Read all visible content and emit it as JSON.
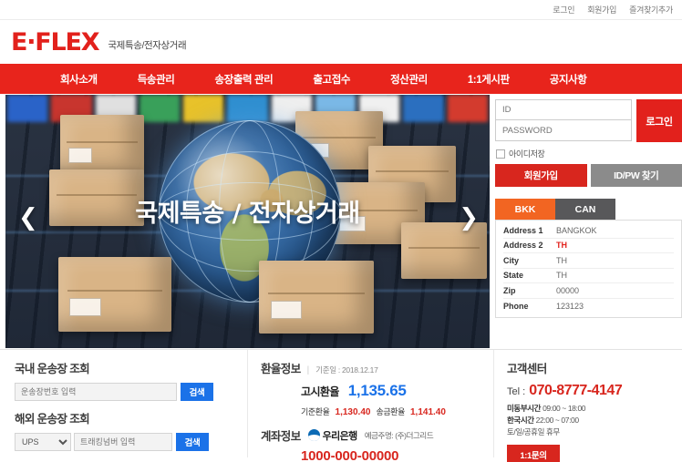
{
  "topbar": {
    "links": [
      {
        "label": "로그인",
        "name": "login-link"
      },
      {
        "label": "회원가입",
        "name": "signup-link"
      },
      {
        "label": "즐겨찾기추가",
        "name": "bookmark-link"
      }
    ]
  },
  "brand": {
    "logo": "E·FLEX",
    "tagline": "국제특송/전자상거래"
  },
  "nav": {
    "items": [
      {
        "label": "회사소개"
      },
      {
        "label": "득송관리"
      },
      {
        "label": "송장출력 관리"
      },
      {
        "label": "출고접수"
      },
      {
        "label": "정산관리"
      },
      {
        "label": "1:1게시판"
      },
      {
        "label": "공지사항"
      }
    ]
  },
  "hero": {
    "caption": "국제특송 / 전자상거래",
    "prev_arrow": "❮",
    "next_arrow": "❯"
  },
  "login": {
    "id_placeholder": "ID",
    "password_placeholder": "PASSWORD",
    "submit_label": "로그인",
    "remember_label": "아이디저장",
    "join_label": "회원가입",
    "find_label": "ID/PW 찾기"
  },
  "address": {
    "tabs": [
      {
        "label": "BKK",
        "active": true
      },
      {
        "label": "CAN",
        "active": false
      }
    ],
    "rows": [
      {
        "key": "Address 1",
        "value": "BANGKOK",
        "highlight": false
      },
      {
        "key": "Address 2",
        "value": "TH",
        "highlight": true
      },
      {
        "key": "City",
        "value": "TH",
        "highlight": false
      },
      {
        "key": "State",
        "value": "TH",
        "highlight": false
      },
      {
        "key": "Zip",
        "value": "00000",
        "highlight": false
      },
      {
        "key": "Phone",
        "value": "123123",
        "highlight": false
      }
    ]
  },
  "domestic_tracking": {
    "title": "국내 운송장 조회",
    "input_placeholder": "운송장번호 입력",
    "search_label": "검색"
  },
  "overseas_tracking": {
    "title": "해외 운송장 조회",
    "carrier_selected": "UPS",
    "carrier_options": [
      "UPS"
    ],
    "input_placeholder": "트래킹넘버 입력",
    "search_label": "검색"
  },
  "exchange": {
    "label": "환율정보",
    "separator": "|",
    "date": "기준일 : 2018.12.17",
    "main_key": "고시환율",
    "main_value": "1,135.65",
    "base_key": "기준환율",
    "base_value": "1,130.40",
    "remit_key": "송금환율",
    "remit_value": "1,141.40"
  },
  "account": {
    "label": "계좌정보",
    "bank": "우리은행",
    "holder": "예금주명: (주)더그리드",
    "number": "1000-000-00000"
  },
  "customer_center": {
    "title": "고객센터",
    "tel_label": "Tel :",
    "tel_value": "070-8777-4147",
    "hours_us_label": "미동부시간",
    "hours_us_value": "09:00 ~ 18:00",
    "hours_kr_label": "한국시간",
    "hours_kr_value": "22:00 ~ 07:00",
    "closed": "토/일/공휴일 휴무",
    "inquiry_label": "1:1문의"
  },
  "colors": {
    "brand_red": "#e2211c",
    "nav_red": "#e8241c",
    "accent_orange": "#f26522",
    "tab_gray": "#58585a",
    "search_blue": "#1b72e8"
  }
}
